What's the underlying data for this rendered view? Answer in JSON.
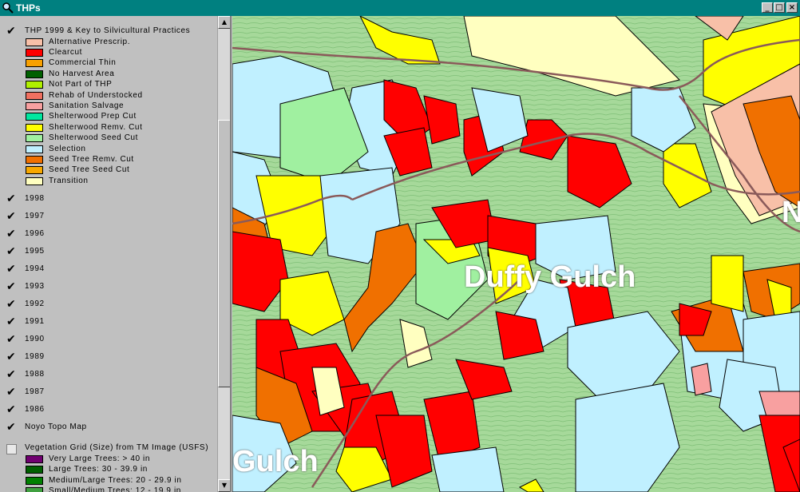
{
  "window": {
    "title": "THPs",
    "minimize": "_",
    "maximize": "□",
    "close": "×"
  },
  "legend": {
    "thp1999": {
      "title": "THP 1999 & Key to Silvicultural Practices",
      "classes": [
        {
          "label": "Alternative Prescrip.",
          "color": "#f8c0a8"
        },
        {
          "label": "Clearcut",
          "color": "#ff0000"
        },
        {
          "label": "Commercial Thin",
          "color": "#f8a000"
        },
        {
          "label": "No Harvest Area",
          "color": "#006000"
        },
        {
          "label": "Not Part of THP",
          "color": "#b0f000"
        },
        {
          "label": "Rehab of Understocked",
          "color": "#f07060"
        },
        {
          "label": "Sanitation Salvage",
          "color": "#f8a0a0"
        },
        {
          "label": "Shelterwood Prep Cut",
          "color": "#00e8a0"
        },
        {
          "label": "Shelterwood Remv. Cut",
          "color": "#ffff00"
        },
        {
          "label": "Shelterwood Seed Cut",
          "color": "#a0f0a0"
        },
        {
          "label": "Selection",
          "color": "#c0f0ff"
        },
        {
          "label": "Seed Tree Remv. Cut",
          "color": "#f07000"
        },
        {
          "label": "Seed Tree Seed Cut",
          "color": "#f8a800"
        },
        {
          "label": "Transition",
          "color": "#ffffc0"
        }
      ]
    },
    "years": [
      "1998",
      "1997",
      "1996",
      "1995",
      "1994",
      "1993",
      "1992",
      "1991",
      "1990",
      "1989",
      "1988",
      "1987",
      "1986"
    ],
    "topo": "Noyo Topo Map",
    "vegetation": {
      "title": "Vegetation Grid (Size) from TM Image (USFS)",
      "classes": [
        {
          "label": "Very Large Trees: > 40  in",
          "color": "#700070"
        },
        {
          "label": "Large Trees: 30 - 39.9 in",
          "color": "#006000"
        },
        {
          "label": "Medium/Large Trees: 20 - 29.9 in",
          "color": "#008000"
        },
        {
          "label": "Small/Medium Trees: 12 - 19.9 in",
          "color": "#40a040"
        }
      ]
    }
  },
  "map": {
    "labels": [
      "Duffy Gulch",
      "Gulch",
      "N"
    ]
  }
}
